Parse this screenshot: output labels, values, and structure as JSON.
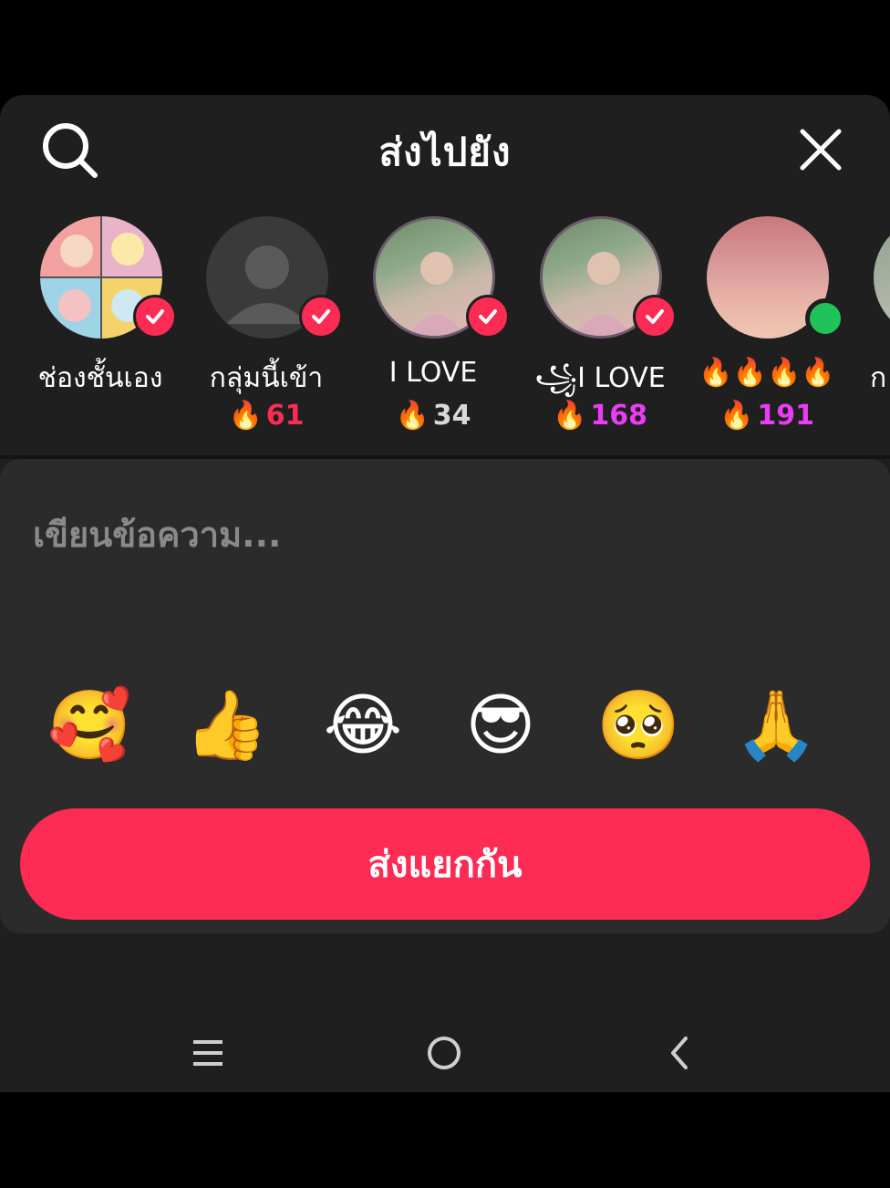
{
  "header": {
    "title": "ส่งไปยัง",
    "search_icon": "search-icon",
    "close_icon": "close-icon"
  },
  "contacts": [
    {
      "name": "ช่องชั้นเอง",
      "streak": "",
      "status": "selected"
    },
    {
      "name": "กลุ่มนี้เข้า",
      "streak": "61",
      "streak_color": "#fe2c55",
      "status": "selected"
    },
    {
      "name": "I LOVE",
      "streak": "34",
      "streak_color": "#d9d9d9",
      "status": "selected"
    },
    {
      "name": "I LOVE",
      "name_prefix": "꧁",
      "streak": "168",
      "streak_color": "#e93cf5",
      "status": "selected"
    },
    {
      "name": "🔥🔥🔥🔥",
      "streak": "191",
      "streak_color": "#e93cf5",
      "status": "online"
    },
    {
      "name": "ก",
      "streak": "",
      "status": "none"
    }
  ],
  "compose": {
    "placeholder": "เขียนข้อความ...",
    "emojis": [
      "🥰",
      "👍",
      "😂",
      "😎",
      "🥺",
      "🙏"
    ],
    "send_label": "ส่งแยกกัน"
  },
  "colors": {
    "accent": "#fe2c55",
    "sheet_bg": "#1f1f1f",
    "compose_bg": "#2b2b2b",
    "online": "#20c35a"
  },
  "system_nav": {
    "recent_icon": "recent-apps-icon",
    "home_icon": "home-icon",
    "back_icon": "back-icon"
  }
}
